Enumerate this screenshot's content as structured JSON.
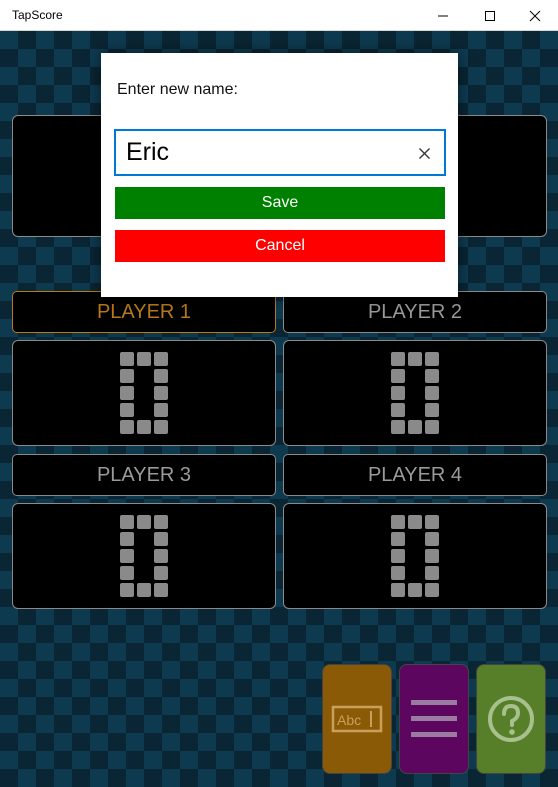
{
  "window": {
    "title": "TapScore",
    "minimize_icon": "minimize-icon",
    "maximize_icon": "maximize-icon",
    "close_icon": "close-icon"
  },
  "players": [
    {
      "name": "PLAYER 1",
      "score": "0",
      "active": true
    },
    {
      "name": "PLAYER 2",
      "score": "0",
      "active": false
    },
    {
      "name": "PLAYER 3",
      "score": "0",
      "active": false
    },
    {
      "name": "PLAYER 4",
      "score": "0",
      "active": false
    }
  ],
  "actions": {
    "rename_icon": "abc-rename-icon",
    "menu_icon": "hamburger-menu-icon",
    "help_icon": "question-help-icon",
    "colors": {
      "rename": "#8a5a06",
      "menu": "#5c0660",
      "help": "#577f2a"
    }
  },
  "dialog": {
    "prompt": "Enter new name:",
    "input_value": "Eric",
    "clear_icon": "clear-x-icon",
    "save_label": "Save",
    "cancel_label": "Cancel",
    "colors": {
      "save": "#008000",
      "cancel": "#ff0000",
      "focus": "#0078d7"
    }
  },
  "theme": {
    "active_player": "#b87a1a",
    "inactive_text": "#9a9a9a"
  }
}
